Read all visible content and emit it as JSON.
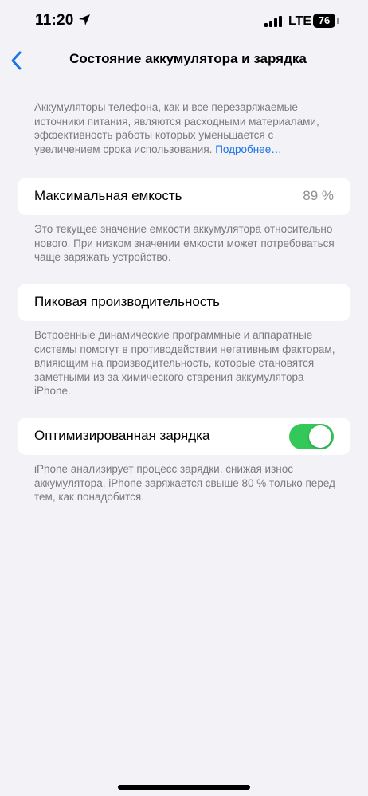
{
  "status_bar": {
    "time": "11:20",
    "network": "LTE",
    "battery_level": "76"
  },
  "nav": {
    "title": "Состояние аккумулятора и зарядка"
  },
  "intro": {
    "text": "Аккумуляторы телефона, как и все перезаряжаемые источники питания, являются расходными материалами, эффективность работы которых уменьшается с увеличением срока использования.",
    "link": "Подробнее…"
  },
  "max_capacity": {
    "label": "Максимальная емкость",
    "value": "89 %",
    "footer": "Это текущее значение емкости аккумулятора относительно нового. При низком значении емкости может потребоваться чаще заряжать устройство."
  },
  "peak_performance": {
    "label": "Пиковая производительность",
    "footer": "Встроенные динамические программные и аппаратные системы помогут в противодействии негативным факторам, влияющим на производительность, которые становятся заметными из-за химического старения аккумулятора iPhone."
  },
  "optimized_charging": {
    "label": "Оптимизированная зарядка",
    "enabled": true,
    "footer": "iPhone анализирует процесс зарядки, снижая износ аккумулятора. iPhone заряжается свыше 80 % только перед тем, как понадобится."
  },
  "colors": {
    "background": "#f2f2f7",
    "accent": "#1a73e8",
    "toggle_on": "#34c759",
    "secondary_text": "#7a7a7f"
  }
}
